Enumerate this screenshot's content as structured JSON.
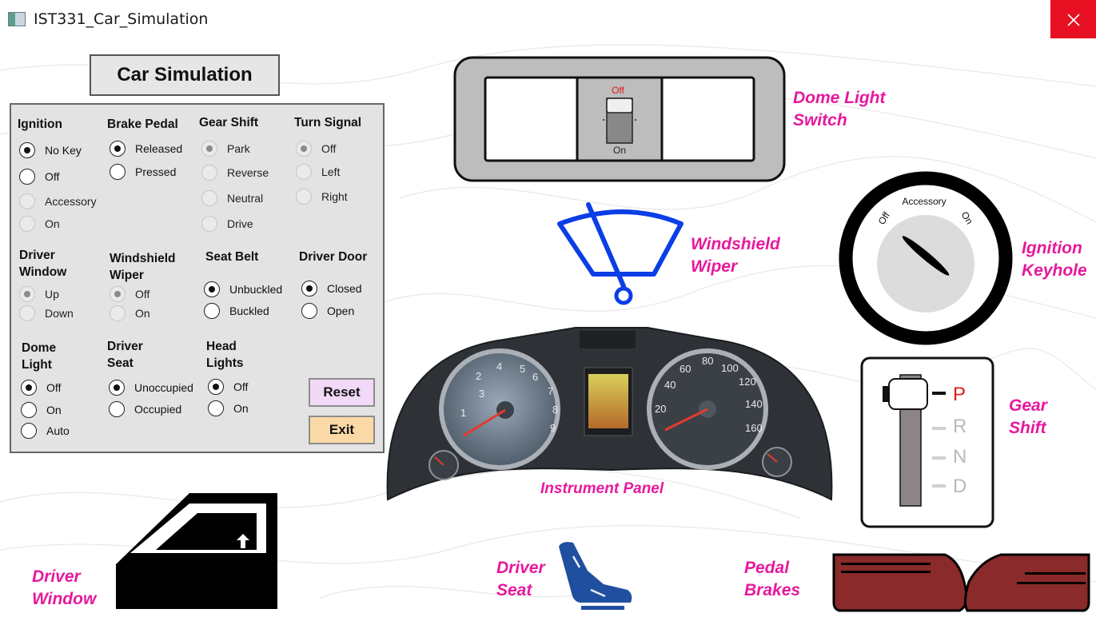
{
  "window": {
    "title": "IST331_Car_Simulation",
    "close_icon": "close-icon"
  },
  "panel": {
    "title": "Car Simulation",
    "groups": {
      "ignition": {
        "title": "Ignition",
        "options": [
          "No Key",
          "Off",
          "Accessory",
          "On"
        ],
        "selected": "No Key"
      },
      "brake_pedal": {
        "title": "Brake Pedal",
        "options": [
          "Released",
          "Pressed"
        ],
        "selected": "Released"
      },
      "gear_shift": {
        "title": "Gear Shift",
        "options": [
          "Park",
          "Reverse",
          "Neutral",
          "Drive"
        ],
        "selected": "Park"
      },
      "turn_signal": {
        "title": "Turn Signal",
        "options": [
          "Off",
          "Left",
          "Right"
        ],
        "selected": "Off"
      },
      "driver_window": {
        "title_line1": "Driver",
        "title_line2": "Window",
        "options": [
          "Up",
          "Down"
        ],
        "selected": "Up"
      },
      "windshield_wiper": {
        "title_line1": "Windshield",
        "title_line2": "Wiper",
        "options": [
          "Off",
          "On"
        ],
        "selected": "Off"
      },
      "seat_belt": {
        "title": "Seat Belt",
        "options": [
          "Unbuckled",
          "Buckled"
        ],
        "selected": "Unbuckled"
      },
      "driver_door": {
        "title": "Driver Door",
        "options": [
          "Closed",
          "Open"
        ],
        "selected": "Closed"
      },
      "dome_light": {
        "title_line1": "Dome",
        "title_line2": "Light",
        "options": [
          "Off",
          "On",
          "Auto"
        ],
        "selected": "Off"
      },
      "driver_seat": {
        "title_line1": "Driver",
        "title_line2": "Seat",
        "options": [
          "Unoccupied",
          "Occupied"
        ],
        "selected": "Unoccupied"
      },
      "head_lights": {
        "title_line1": "Head",
        "title_line2": "Lights",
        "options": [
          "Off",
          "On"
        ],
        "selected": "Off"
      }
    },
    "buttons": {
      "reset": "Reset",
      "exit": "Exit"
    }
  },
  "dome_switch": {
    "off_label": "Off",
    "on_label": "On",
    "state": "Off"
  },
  "ignition_keyhole": {
    "accessory": "Accessory",
    "off": "Off",
    "on": "On",
    "position": "No Key"
  },
  "instrument_panel": {
    "tach_labels": [
      "1",
      "2",
      "3",
      "4",
      "5",
      "6",
      "7",
      "8",
      "9"
    ],
    "speed_labels": [
      "20",
      "40",
      "60",
      "80",
      "100",
      "120",
      "140",
      "160"
    ]
  },
  "gear_indicator": {
    "gears": [
      "P",
      "R",
      "N",
      "D"
    ],
    "selected": "P",
    "active_color": "#e11a1a",
    "inactive_color": "#b9b9b9"
  },
  "labels": {
    "dome_light_switch": [
      "Dome Light",
      "Switch"
    ],
    "windshield_wiper": [
      "Windshield",
      "Wiper"
    ],
    "ignition_keyhole": [
      "Ignition",
      "Keyhole"
    ],
    "gear_shift": [
      "Gear",
      "Shift"
    ],
    "instrument_panel": "Instrument Panel",
    "driver_window": [
      "Driver",
      "Window"
    ],
    "driver_seat": [
      "Driver",
      "Seat"
    ],
    "pedal_brakes": [
      "Pedal",
      "Brakes"
    ]
  },
  "colors": {
    "label_pink": "#e6199d",
    "wiper_blue": "#0a3ee6",
    "seat_blue": "#1f4f9e",
    "brake_red": "#8a2a2a",
    "close_red": "#e81123"
  }
}
